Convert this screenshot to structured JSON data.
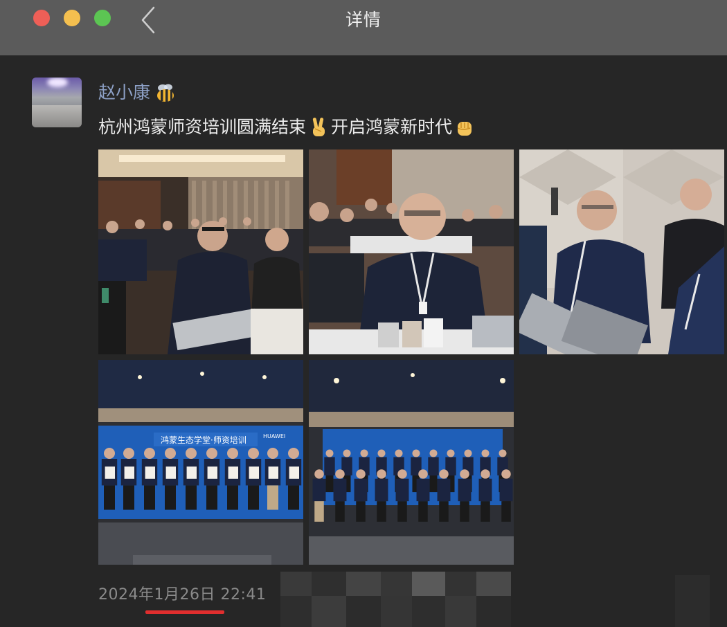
{
  "window": {
    "title": "详情",
    "back_icon": "chevron-left-icon"
  },
  "post": {
    "author": "赵小康",
    "author_emoji": "bee",
    "text_part1": "杭州鸿蒙师资培训圆满结束",
    "emoji1": "victory-hand",
    "text_part2": "开启鸿蒙新时代",
    "emoji2": "raised-fist",
    "timestamp": "2024年1月26日 22:41",
    "photos": [
      {
        "name": "photo-classroom-wide"
      },
      {
        "name": "photo-attendee-closeup"
      },
      {
        "name": "photo-attendee-profile"
      },
      {
        "name": "photo-certificate-group"
      },
      {
        "name": "photo-group-thumbs-up"
      }
    ],
    "banner_text": "鸿蒙生态学堂·师资培训",
    "banner_brand": "HUAWEI"
  },
  "colors": {
    "titlebar": "#5b5b5b",
    "background": "#262626",
    "author_name": "#8da0c6",
    "timestamp": "#8a8a8a",
    "highlight": "#e02e2e"
  }
}
